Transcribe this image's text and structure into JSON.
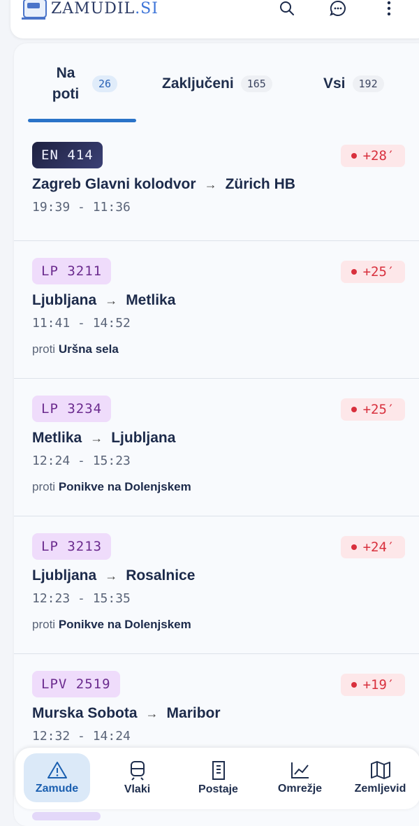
{
  "app": {
    "logo_main": "ZAMUDIL",
    "logo_suffix": ".SI"
  },
  "header_icons": [
    "search-icon",
    "chat-icon",
    "more-vert-icon"
  ],
  "tabs": [
    {
      "label": "Na poti",
      "count": "26",
      "active": true
    },
    {
      "label": "Zaključeni",
      "count": "165",
      "active": false
    },
    {
      "label": "Vsi",
      "count": "192",
      "active": false
    }
  ],
  "trains": [
    {
      "id": "EN 414",
      "type": "en",
      "delay": "+28′",
      "from": "Zagreb Glavni kolodvor",
      "to": "Zürich HB",
      "times": "19:39 - 11:36",
      "direction_prefix": "",
      "direction": ""
    },
    {
      "id": "LP 3211",
      "type": "lp",
      "delay": "+25′",
      "from": "Ljubljana",
      "to": "Metlika",
      "times": "11:41 - 14:52",
      "direction_prefix": "proti",
      "direction": "Uršna sela"
    },
    {
      "id": "LP 3234",
      "type": "lp",
      "delay": "+25′",
      "from": "Metlika",
      "to": "Ljubljana",
      "times": "12:24 - 15:23",
      "direction_prefix": "proti",
      "direction": "Ponikve na Dolenjskem"
    },
    {
      "id": "LP 3213",
      "type": "lp",
      "delay": "+24′",
      "from": "Ljubljana",
      "to": "Rosalnice",
      "times": "12:23 - 15:35",
      "direction_prefix": "proti",
      "direction": "Ponikve na Dolenjskem"
    },
    {
      "id": "LPV 2519",
      "type": "lp",
      "delay": "+19′",
      "from": "Murska Sobota",
      "to": "Maribor",
      "times": "12:32 - 14:24",
      "direction_prefix": "",
      "direction": ""
    }
  ],
  "arrow": "→",
  "nav": [
    {
      "label": "Zamude",
      "icon": "warning-icon",
      "active": true
    },
    {
      "label": "Vlaki",
      "icon": "train-icon",
      "active": false
    },
    {
      "label": "Postaje",
      "icon": "building-icon",
      "active": false
    },
    {
      "label": "Omrežje",
      "icon": "chart-line-icon",
      "active": false
    },
    {
      "label": "Zemljevid",
      "icon": "map-icon",
      "active": false
    }
  ],
  "colors": {
    "accent": "#2a73c8",
    "delay_bg": "#fde7e9",
    "delay_text": "#d8303d",
    "lp_badge": "#efdcfb"
  }
}
